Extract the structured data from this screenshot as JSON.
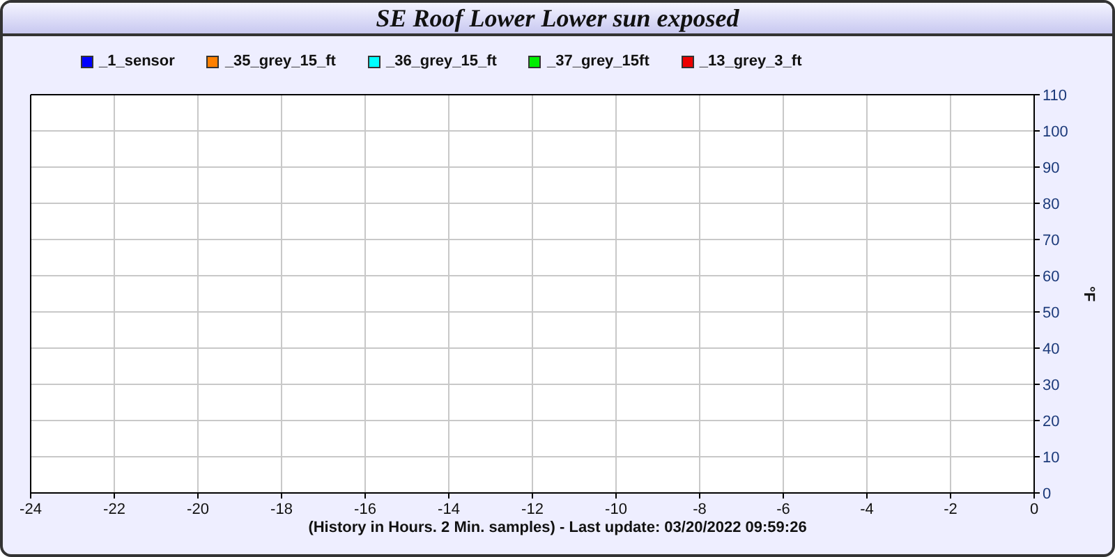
{
  "window": {
    "title": "SE Roof Lower Lower sun exposed"
  },
  "chart": {
    "chart_data": {
      "type": "line",
      "xlabel": "(History in Hours. 2 Min. samples) - Last update: 03/20/2022 09:59:26",
      "ylabel": "°F",
      "categories": [
        "-24",
        "-22",
        "-20",
        "-18",
        "-16",
        "-14",
        "-12",
        "-10",
        "-8",
        "-6",
        "-4",
        "-2",
        "0"
      ],
      "series": [
        {
          "name": "_1_sensor",
          "color": "#0000ff",
          "values": [
            null,
            null,
            null,
            null,
            null,
            null,
            null,
            null,
            null,
            null,
            null,
            null,
            null
          ]
        },
        {
          "name": "_35_grey_15_ft",
          "color": "#ff8000",
          "values": [
            null,
            null,
            null,
            null,
            null,
            null,
            null,
            null,
            null,
            null,
            null,
            null,
            null
          ]
        },
        {
          "name": "_36_grey_15_ft",
          "color": "#00ffff",
          "values": [
            null,
            null,
            null,
            null,
            null,
            null,
            null,
            null,
            null,
            null,
            null,
            null,
            null
          ]
        },
        {
          "name": "_37_grey_15ft",
          "color": "#00ee00",
          "values": [
            null,
            null,
            null,
            null,
            null,
            null,
            null,
            null,
            null,
            null,
            null,
            null,
            null
          ]
        },
        {
          "name": "_13_grey_3_ft",
          "color": "#ee0000",
          "values": [
            null,
            null,
            null,
            null,
            null,
            null,
            null,
            null,
            null,
            null,
            null,
            null,
            null
          ]
        }
      ],
      "ylim": [
        0,
        110
      ],
      "yticks": [
        0,
        10,
        20,
        30,
        40,
        50,
        60,
        70,
        80,
        90,
        100,
        110
      ],
      "grid": true
    }
  }
}
